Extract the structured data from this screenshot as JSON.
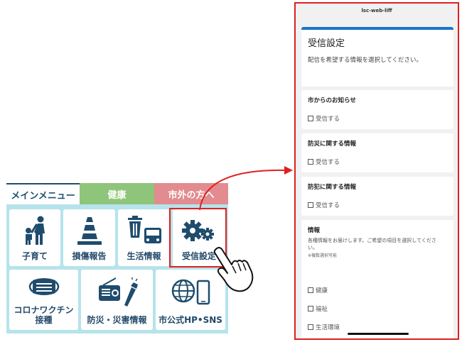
{
  "rich_menu": {
    "tabs": [
      {
        "label": "メインメニュー",
        "color": "#ffffff"
      },
      {
        "label": "健康",
        "color": "#8fc57a"
      },
      {
        "label": "市外の方へ",
        "color": "#e28c8f"
      }
    ],
    "tiles": [
      {
        "label": "子育て",
        "icon": "parent-child-icon"
      },
      {
        "label": "損傷報告",
        "icon": "traffic-cone-icon"
      },
      {
        "label": "生活情報",
        "icon": "trash-bus-icon"
      },
      {
        "label": "受信設定",
        "icon": "gears-icon"
      },
      {
        "label": "コロナワクチン",
        "label2": "接種",
        "icon": "mask-icon"
      },
      {
        "label": "防災・災害情報",
        "icon": "radio-flashlight-icon"
      },
      {
        "label": "市公式HP•SNS",
        "icon": "globe-phone-icon"
      }
    ]
  },
  "phone": {
    "app_title": "lsc-web-liff",
    "header": {
      "title": "受信設定",
      "description": "配信を希望する情報を選択してください。"
    },
    "sections": [
      {
        "title": "市からのお知らせ",
        "checkbox": "受信する"
      },
      {
        "title": "防災に関する情報",
        "checkbox": "受信する"
      },
      {
        "title": "防犯に関する情報",
        "checkbox": "受信する"
      }
    ],
    "info_section": {
      "title": "情報",
      "subtitle": "各種情報をお届けします。ご希望の項目を選択してくださ い。",
      "note": "※複数選択可能",
      "options": [
        "健康",
        "福祉",
        "生活環境"
      ]
    }
  },
  "colors": {
    "accent_red": "#e02020",
    "header_blue": "#1a74c9",
    "menu_bg": "#b6e3ec",
    "icon_navy": "#1f4c6d"
  }
}
